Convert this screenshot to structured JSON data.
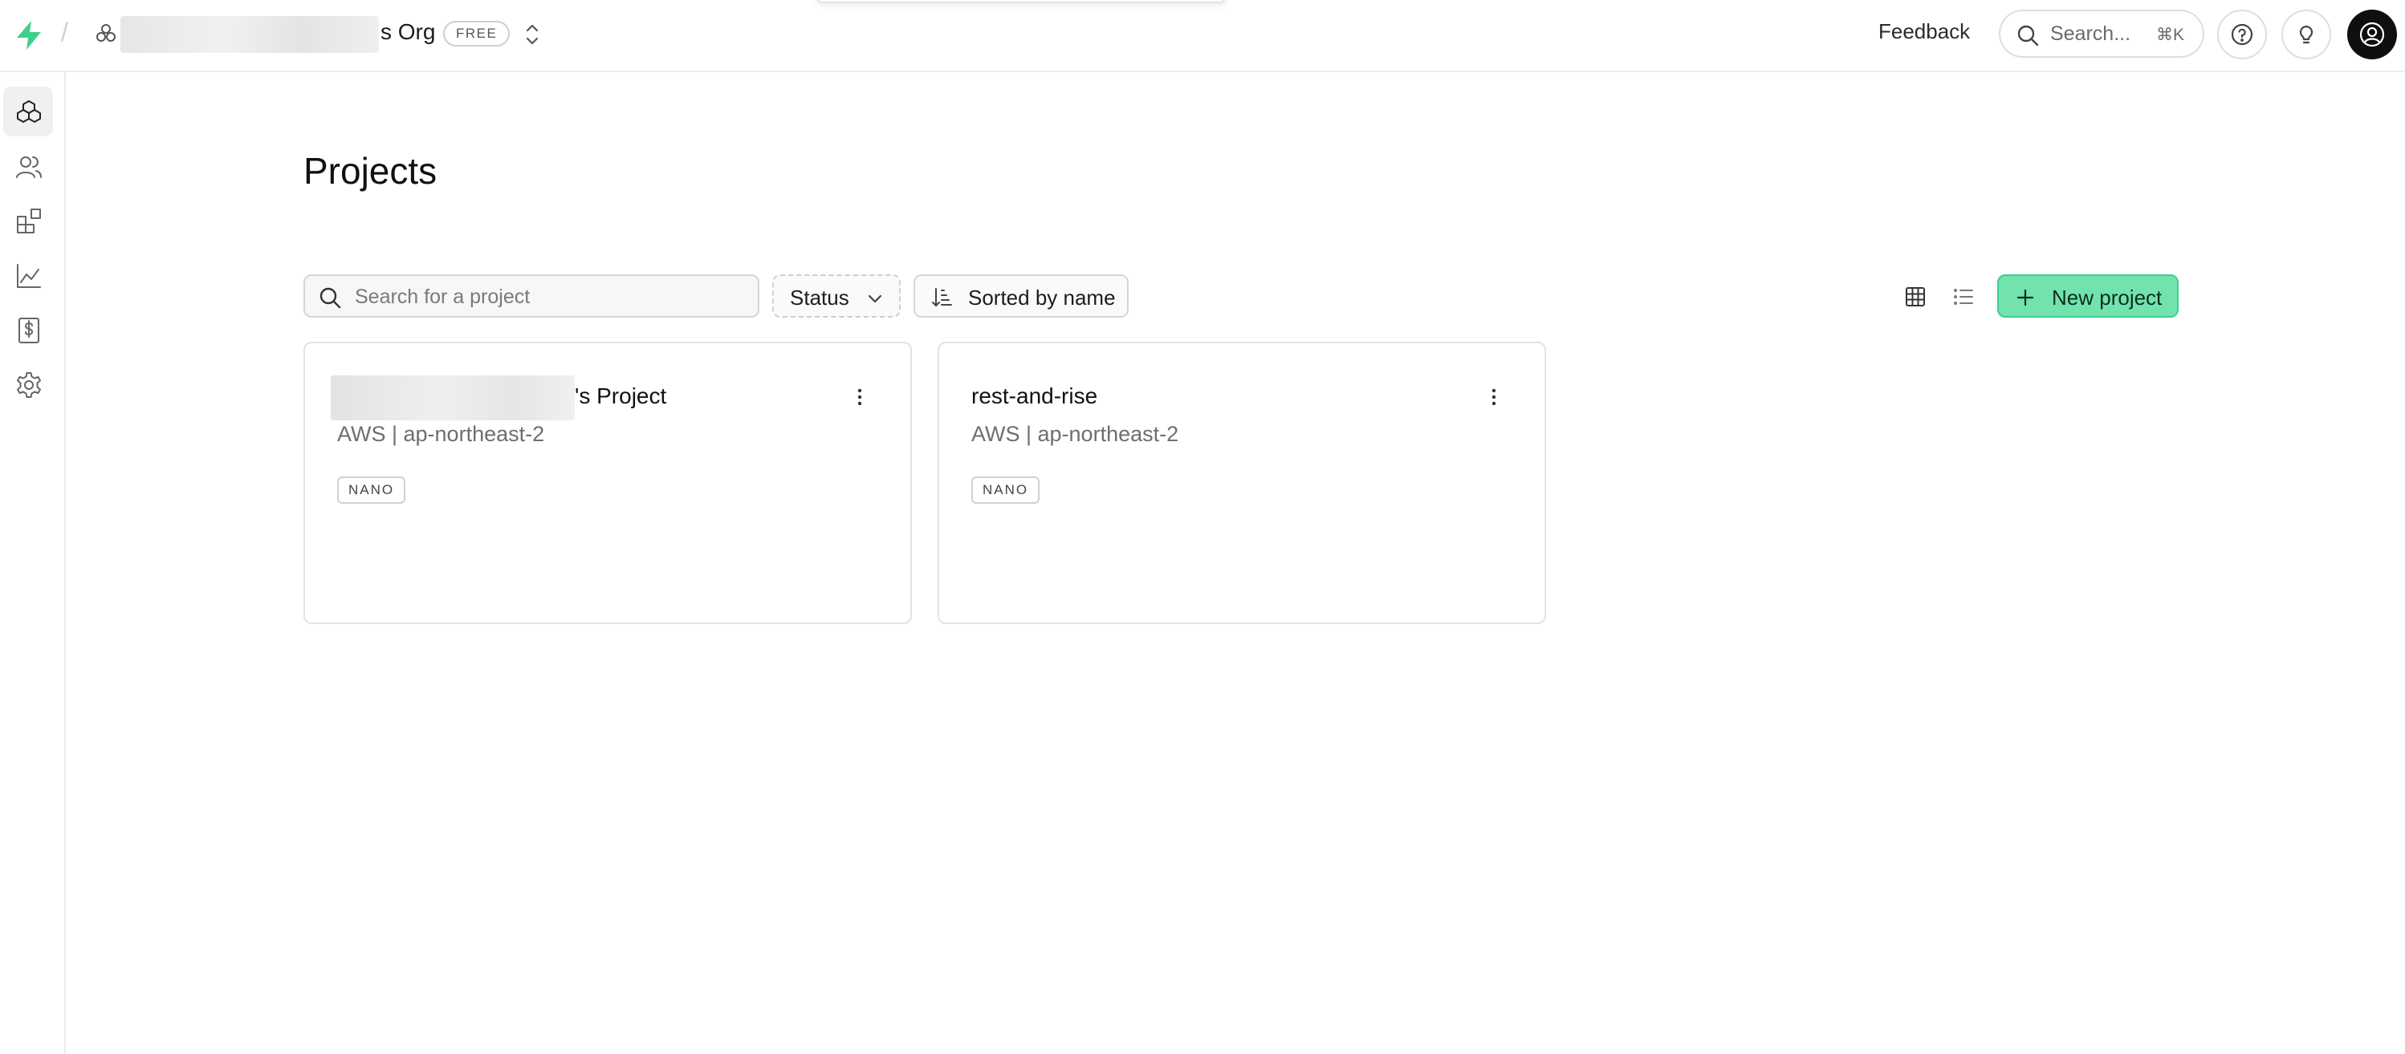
{
  "topbar": {
    "org_name_suffix": "s Org",
    "plan_badge": "FREE",
    "feedback_label": "Feedback",
    "search_label": "Search...",
    "search_shortcut": "⌘K",
    "icons": [
      "supabase-logo-icon",
      "org-icon",
      "chevrons-up-down-icon",
      "search-icon",
      "help-icon",
      "lightbulb-icon",
      "user-avatar-icon"
    ]
  },
  "sidebar": {
    "items": [
      {
        "name": "projects",
        "icon": "boxes-icon",
        "active": true
      },
      {
        "name": "team",
        "icon": "users-icon",
        "active": false
      },
      {
        "name": "integrations",
        "icon": "blocks-icon",
        "active": false
      },
      {
        "name": "usage",
        "icon": "chart-icon",
        "active": false
      },
      {
        "name": "billing",
        "icon": "billing-icon",
        "active": false
      },
      {
        "name": "settings",
        "icon": "gear-icon",
        "active": false
      }
    ]
  },
  "main": {
    "title": "Projects",
    "search_placeholder": "Search for a project",
    "status_filter_label": "Status",
    "sort_label": "Sorted by name",
    "new_project_label": "New project",
    "projects": [
      {
        "name": "'s Project",
        "region": "AWS | ap-northeast-2",
        "size": "NANO"
      },
      {
        "name": "rest-and-rise",
        "region": "AWS | ap-northeast-2",
        "size": "NANO"
      }
    ]
  },
  "colors": {
    "brand_green": "#3ecf8e",
    "button_green": "#72e3ad",
    "border": "#e3e3e3",
    "muted_text": "#6e6e6e"
  }
}
